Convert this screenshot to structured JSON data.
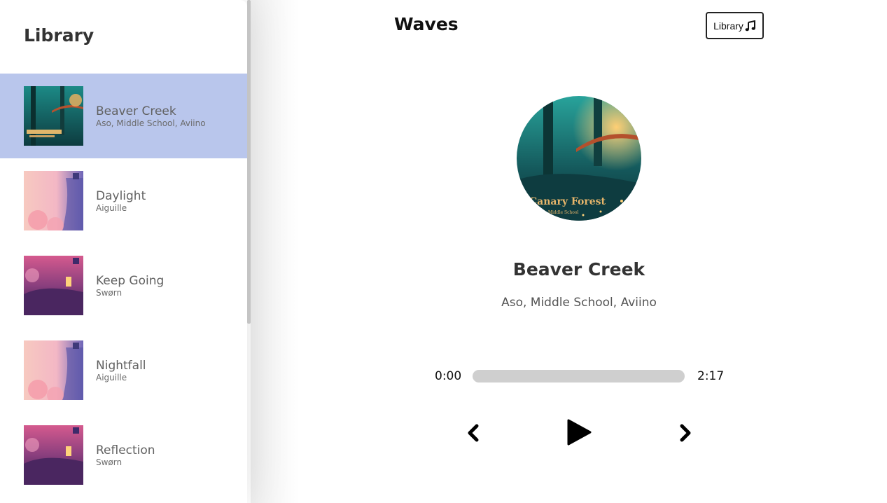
{
  "library": {
    "title": "Library",
    "songs": [
      {
        "name": "Beaver Creek",
        "artist": "Aso, Middle School, Aviino",
        "active": true
      },
      {
        "name": "Daylight",
        "artist": "Aiguille",
        "active": false
      },
      {
        "name": "Keep Going",
        "artist": "Swørn",
        "active": false
      },
      {
        "name": "Nightfall",
        "artist": "Aiguille",
        "active": false
      },
      {
        "name": "Reflection",
        "artist": "Swørn",
        "active": false
      }
    ]
  },
  "header": {
    "title": "Waves",
    "library_button_label": "Library",
    "library_button_icon": "music-note-icon"
  },
  "player": {
    "track_name": "Beaver Creek",
    "track_artist": "Aso, Middle School, Aviino",
    "current_time": "0:00",
    "duration": "2:17",
    "progress_fraction": 0,
    "controls": [
      "previous-icon",
      "play-icon",
      "next-icon"
    ]
  },
  "colors": {
    "active_song_bg": "#b9c6ec",
    "progress_track": "#cfcfcf"
  }
}
